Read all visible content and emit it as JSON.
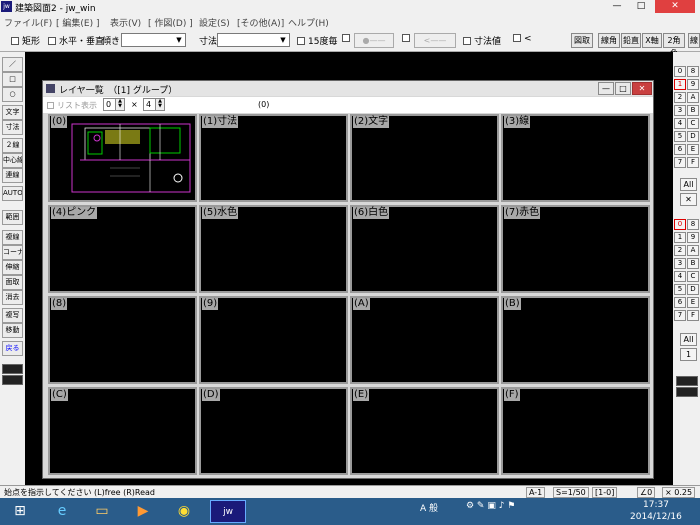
{
  "window": {
    "title": "建築図面2 - jw_win",
    "app_icon": "jw",
    "controls": {
      "minimize": "—",
      "maximize": "□",
      "close": "✕"
    }
  },
  "menu": [
    "ファイル(F)",
    "[ 編集(E) ]",
    "表示(V)",
    "[ 作図(D) ]",
    "設定(S)",
    "[その他(A)]",
    "ヘルプ(H)"
  ],
  "toolbar": {
    "rect": "矩形",
    "horiz_vert": "水平・垂直",
    "tilt_label": "傾き",
    "dim_label": "寸法",
    "deg15": "15度毎",
    "ghost1": "●——",
    "ghost2": "<——",
    "dim_value": "寸法値",
    "lt": "<",
    "btn_cancel": "図取",
    "btn_line": "線角",
    "btn_perp": "鉛直",
    "btn_x": "X軸",
    "btn_2": "2角角",
    "btn_wire": "線"
  },
  "left_tools": [
    {
      "label": "／",
      "selected": false
    },
    {
      "label": "□",
      "selected": false
    },
    {
      "label": "○",
      "selected": false
    },
    {
      "label": "文字",
      "selected": false
    },
    {
      "label": "寸法",
      "selected": false
    },
    {
      "label": "２線",
      "selected": false
    },
    {
      "label": "中心線",
      "selected": false
    },
    {
      "label": "連線",
      "selected": false
    },
    {
      "label": "AUTO",
      "selected": false
    },
    {
      "label": "範囲",
      "selected": false
    },
    {
      "label": "複線",
      "selected": false
    },
    {
      "label": "コーナー",
      "selected": false
    },
    {
      "label": "伸縮",
      "selected": false
    },
    {
      "label": "面取",
      "selected": false
    },
    {
      "label": "消去",
      "selected": false
    },
    {
      "label": "複写",
      "selected": false
    },
    {
      "label": "移動",
      "selected": false
    },
    {
      "label": "戻る",
      "selected": true
    }
  ],
  "right_layers_top": [
    [
      "0",
      "8"
    ],
    [
      "1",
      "9"
    ],
    [
      "2",
      "A"
    ],
    [
      "3",
      "B"
    ],
    [
      "4",
      "C"
    ],
    [
      "5",
      "D"
    ],
    [
      "6",
      "E"
    ],
    [
      "7",
      "F"
    ]
  ],
  "right_layers_bottom": [
    [
      "0",
      "8"
    ],
    [
      "1",
      "9"
    ],
    [
      "2",
      "A"
    ],
    [
      "3",
      "B"
    ],
    [
      "4",
      "C"
    ],
    [
      "5",
      "D"
    ],
    [
      "6",
      "E"
    ],
    [
      "7",
      "F"
    ]
  ],
  "right_all": "All",
  "right_x": "✕",
  "right_all2": "All",
  "right_one": "1",
  "dialog": {
    "title": "レイヤ一覧　（[1] グループ）",
    "list_display": "リスト表示",
    "spin1": "0",
    "times": "×",
    "spin2": "4",
    "header_zero": "(0)",
    "controls": {
      "minimize": "—",
      "maximize": "□",
      "close": "✕"
    },
    "cells": [
      "(0)",
      "(1)寸法",
      "(2)文字",
      "(3)線",
      "(4)ピンク",
      "(5)水色",
      "(6)白色",
      "(7)赤色",
      "(8)",
      "(9)",
      "(A)",
      "(B)",
      "(C)",
      "(D)",
      "(E)",
      "(F)"
    ]
  },
  "status": {
    "prompt": "始点を指示してください (L)free (R)Read",
    "paper": "A-1",
    "scale": "S=1/50",
    "layer": "[1-0]",
    "angle": "∠0",
    "zoom": "× 0.25"
  },
  "taskbar": {
    "ime": "A 般",
    "time": "17:37",
    "date": "2014/12/16"
  },
  "colors": {
    "cad_bg": "#000000",
    "taskbar": "#2a5c8a",
    "selected_text": "#0000ff",
    "layer_red": "#dd0000"
  }
}
